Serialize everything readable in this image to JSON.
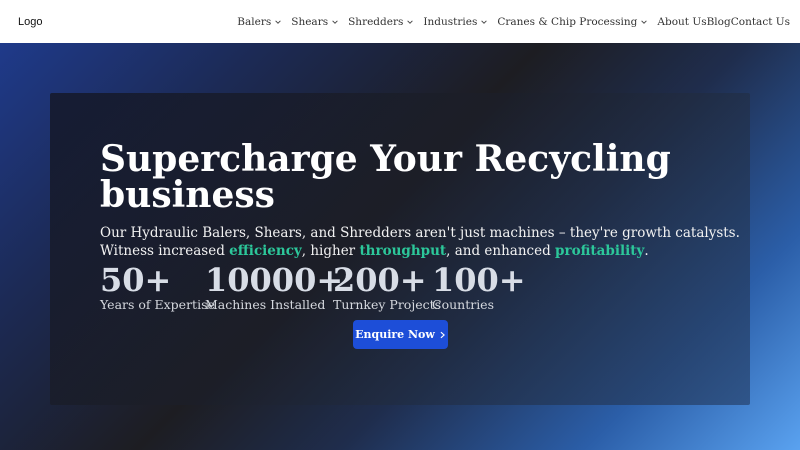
{
  "nav": {
    "logo": "Logo",
    "items": [
      {
        "label": "Balers"
      },
      {
        "label": "Shears"
      },
      {
        "label": "Shredders"
      },
      {
        "label": "Industries"
      },
      {
        "label": "Cranes & Chip Processing"
      },
      {
        "label": "About Us"
      },
      {
        "label": "Blog"
      },
      {
        "label": "Contact Us"
      }
    ]
  },
  "hero": {
    "headline": "Supercharge Your Recycling business",
    "desc_part1": "Our Hydraulic Balers, Shears, and Shredders aren't just machines – they're growth catalysts. Witness increased ",
    "hl1": "efficiency",
    "desc_part2": ", higher ",
    "hl2": "throughput",
    "desc_part3": ", and enhanced ",
    "hl3": "profitability",
    "desc_part4": ".",
    "stats": [
      {
        "value": "50+",
        "label": "Years of Expertise"
      },
      {
        "value": "10000+",
        "label": "Machines Installed"
      },
      {
        "value": "200+",
        "label": "Turnkey Projects"
      },
      {
        "value": "100+",
        "label": "Countries"
      }
    ],
    "cta_label": "Enquire Now"
  },
  "colors": {
    "accent": "#2cc79a",
    "button": "#1d4ed8"
  }
}
